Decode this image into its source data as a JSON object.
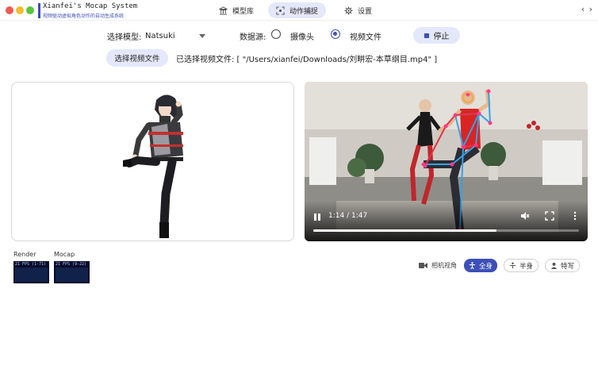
{
  "app": {
    "title": "Xianfei's Mocap System",
    "subtitle": "视频驱动虚拟角色动作的自动生成系统",
    "brand_color": "#3d4fb8"
  },
  "nav": {
    "models": {
      "label": "模型库",
      "icon": "building-icon"
    },
    "mocap": {
      "label": "动作捕捉",
      "icon": "capture-icon",
      "active": true
    },
    "settings": {
      "label": "设置",
      "icon": "gear-icon"
    }
  },
  "window_controls": "‹ ›",
  "controls": {
    "model_label": "选择模型:",
    "model_value": "Natsuki",
    "source_label": "数据源:",
    "source_camera": "摄像头",
    "source_file": "视频文件",
    "source_selected": "视频文件",
    "stop_label": "停止",
    "choose_file_label": "选择视频文件",
    "selected_file_text": "已选择视频文件: [ \"/Users/xianfei/Downloads/刘畊宏-本草纲目.mp4\" ]"
  },
  "video": {
    "time": "1:14 / 1:47",
    "progress": 0.69,
    "icons": [
      "pause-icon",
      "mute-icon",
      "fullscreen-icon",
      "more-icon"
    ]
  },
  "stats": {
    "render_label": "Render",
    "render_fps": "21 FPS (1-71)",
    "mocap_label": "Mocap",
    "mocap_fps": "21 FPS (9-22)"
  },
  "views": {
    "camera_view_label": "相机视角",
    "full_body": "全身",
    "half_body": "半身",
    "close_up": "特写",
    "active": "全身"
  }
}
